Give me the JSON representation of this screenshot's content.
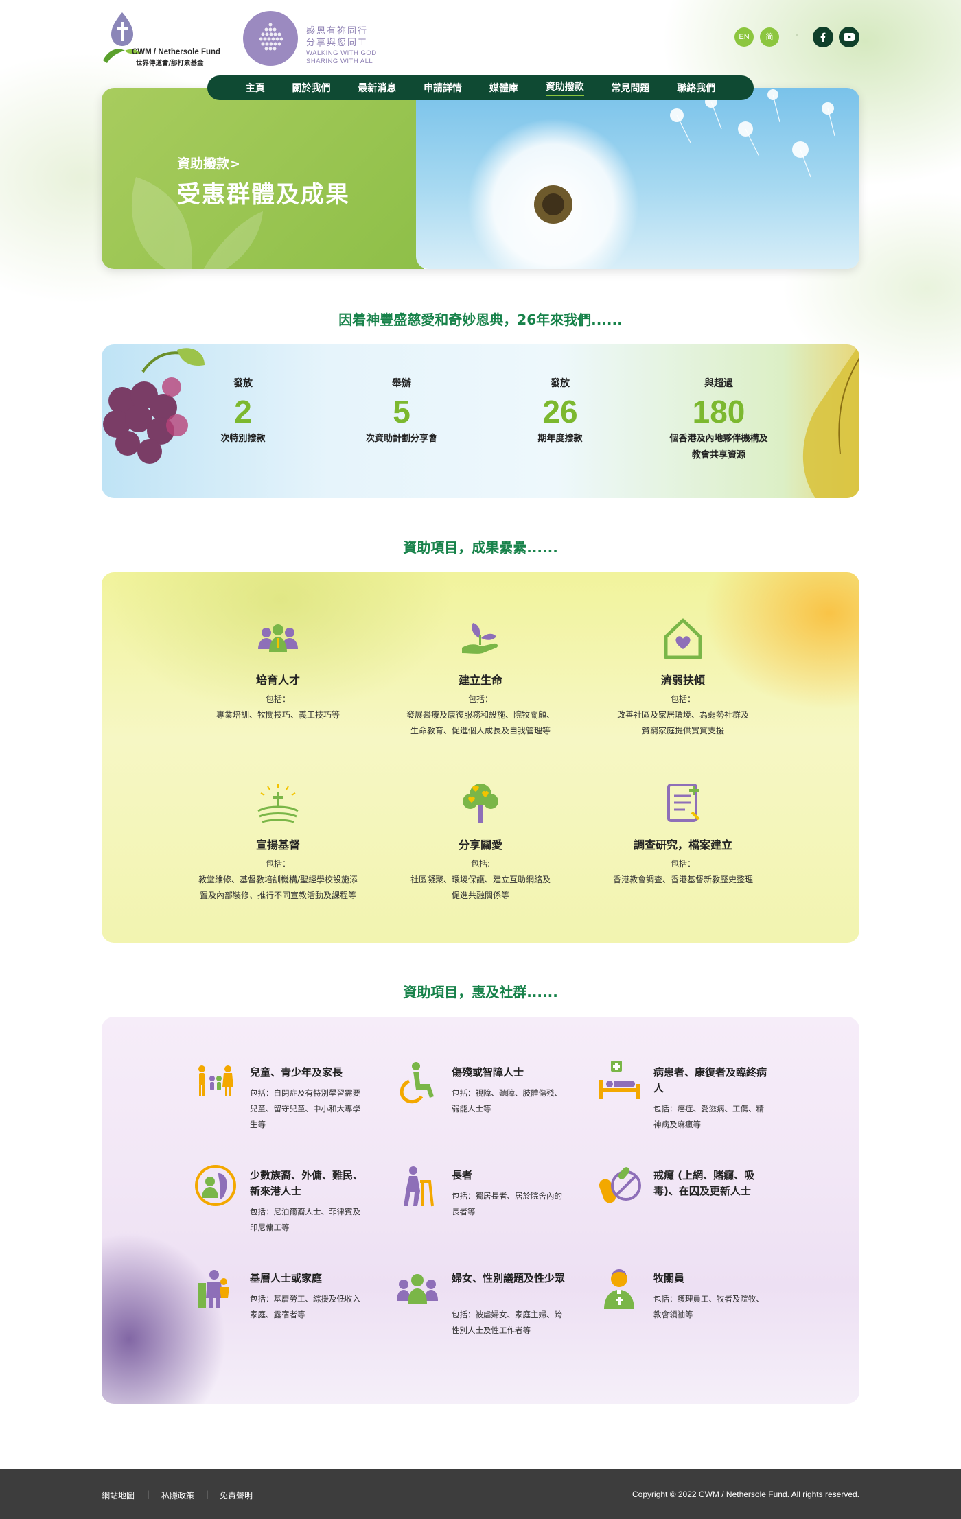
{
  "header": {
    "logo_en": "CWM / Nethersole Fund",
    "logo_zh": "世界傳道會/那打素基金",
    "partner_line1": "感恩有祢同行",
    "partner_line2": "分享與您同工",
    "partner_line3": "WALKING WITH GOD",
    "partner_line4": "SHARING WITH ALL",
    "lang_en": "EN",
    "lang_sc": "简",
    "facebook_icon": "facebook-icon",
    "youtube_icon": "youtube-icon",
    "brand_green": "#8cc63f",
    "nav_color": "#0f4a33"
  },
  "nav": {
    "items": [
      {
        "label": "主頁"
      },
      {
        "label": "關於我們"
      },
      {
        "label": "最新消息"
      },
      {
        "label": "申請詳情"
      },
      {
        "label": "媒體庫"
      },
      {
        "label": "資助撥款"
      },
      {
        "label": "常見問題"
      },
      {
        "label": "聯絡我們"
      }
    ],
    "active": "資助撥款"
  },
  "hero": {
    "breadcrumb": "資助撥款",
    "breadcrumb_arrow": ">",
    "title": "受惠群體及成果"
  },
  "stats_section": {
    "heading": "因着神豐盛慈愛和奇妙恩典，26年來我們......",
    "items": [
      {
        "pre": "發放",
        "num": "2",
        "post": "次特別撥款",
        "post2": ""
      },
      {
        "pre": "舉辦",
        "num": "5",
        "post": "次資助計劃分享會",
        "post2": ""
      },
      {
        "pre": "發放",
        "num": "26",
        "post": "期年度撥款",
        "post2": ""
      },
      {
        "pre": "與超過",
        "num": "180",
        "post": "個香港及內地夥伴機構及",
        "post2": "教會共享資源"
      }
    ]
  },
  "results_section": {
    "heading": "資助項目，成果纍纍......",
    "items": [
      {
        "icon": "people-training-icon",
        "title": "培育人才",
        "sub": "包括：",
        "desc1": "專業培訓、牧關技巧、義工技巧等",
        "desc2": ""
      },
      {
        "icon": "hand-plant-icon",
        "title": "建立生命",
        "sub": "包括：",
        "desc1": "發展醫療及康復服務和設施、院牧關顧、",
        "desc2": "生命教育、促進個人成長及自我管理等"
      },
      {
        "icon": "house-heart-icon",
        "title": "濟弱扶傾",
        "sub": "包括：",
        "desc1": "改善社區及家居環境、為弱勢社群及",
        "desc2": "貧窮家庭提供實質支援"
      },
      {
        "icon": "cross-sunrise-icon",
        "title": "宣揚基督",
        "sub": "包括：",
        "desc1": "教堂維修、基督教培訓機構/聖經學校設施添",
        "desc2": "置及內部裝修、推行不同宣教活動及課程等"
      },
      {
        "icon": "heart-tree-icon",
        "title": "分享關愛",
        "sub": "包括:",
        "desc1": "社區凝聚、環境保護、建立互助網絡及",
        "desc2": "促進共融關係等"
      },
      {
        "icon": "research-document-icon",
        "title": "調查研究，檔案建立",
        "sub": "包括：",
        "desc1": "香港教會調查、香港基督新教歷史整理",
        "desc2": ""
      }
    ]
  },
  "community_section": {
    "heading": "資助項目，惠及社群......",
    "items": [
      {
        "icon": "family-icon",
        "title": "兒童、青少年及家長",
        "desc": "包括：自閉症及有特別學習需要兒童、留守兒童、中小和大專學生等"
      },
      {
        "icon": "wheelchair-icon",
        "title": "傷殘或智障人士",
        "desc": "包括：視障、聽障、肢體傷殘、弱能人士等"
      },
      {
        "icon": "hospital-bed-icon",
        "title": "病患者、康復者及臨終病人",
        "desc": "包括：癌症、愛滋病、工傷、精神病及麻瘋等"
      },
      {
        "icon": "ethnic-minority-icon",
        "title": "少數族裔、外傭、難民、新來港人士",
        "desc": "包括：尼泊爾裔人士、菲律賓及印尼傭工等"
      },
      {
        "icon": "elderly-walker-icon",
        "title": "長者",
        "desc": "包括：獨居長者、居於院舍內的長者等"
      },
      {
        "icon": "addiction-pill-icon",
        "title": "戒癮 (上網、賭癮、吸毒)、在囚及更新人士",
        "desc": ""
      },
      {
        "icon": "grassroots-family-icon",
        "title": "基層人士或家庭",
        "desc": "包括：基層勞工、綜援及低收入家庭、露宿者等"
      },
      {
        "icon": "women-group-icon",
        "title": "婦女、性別議題及性少眾",
        "desc": "包括：被虐婦女、家庭主婦、跨性別人士及性工作者等"
      },
      {
        "icon": "pastor-icon",
        "title": "牧關員",
        "desc": "包括：護理員工、牧者及院牧、教會領袖等"
      }
    ]
  },
  "footer": {
    "links": [
      "網站地圖",
      "私隱政策",
      "免責聲明"
    ],
    "copyright": "Copyright © 2022 CWM / Nethersole Fund. All rights reserved."
  }
}
